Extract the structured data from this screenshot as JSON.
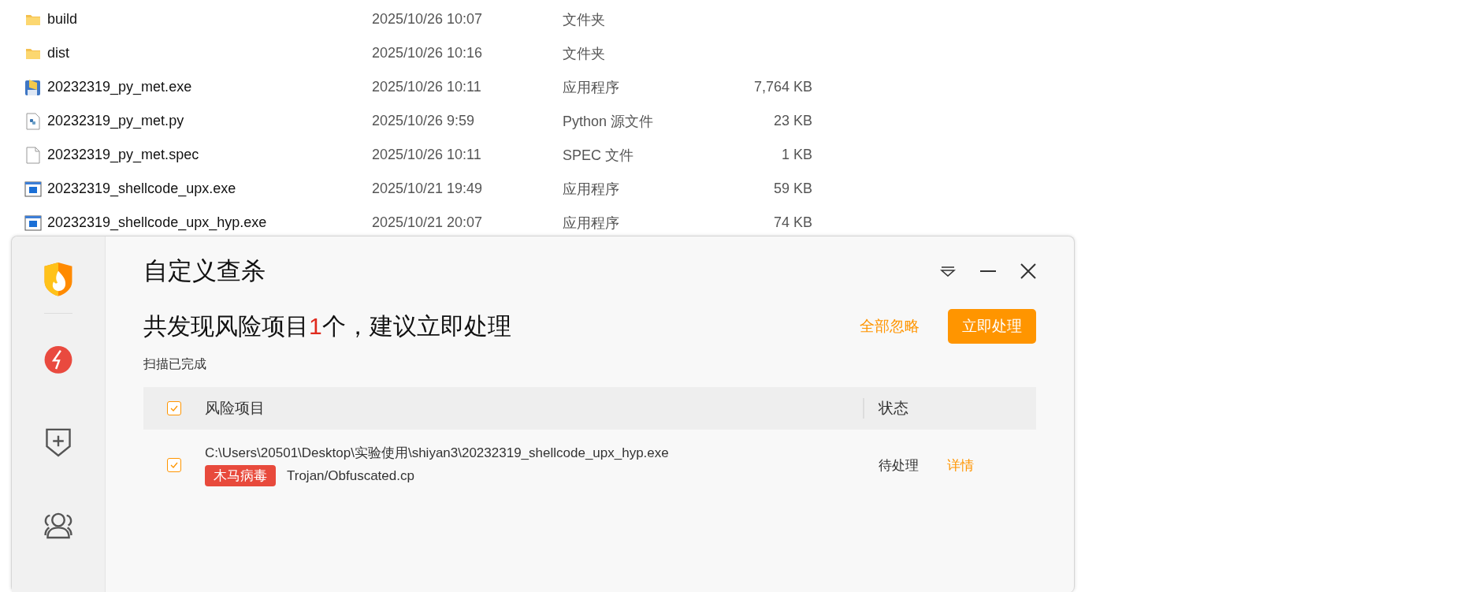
{
  "files": [
    {
      "kind": "folder",
      "name": "build",
      "modified": "2025/10/26 10:07",
      "type": "文件夹"
    },
    {
      "kind": "folder",
      "name": "dist",
      "modified": "2025/10/26 10:16",
      "type": "文件夹"
    },
    {
      "kind": "installer",
      "name": "20232319_py_met.exe",
      "modified": "2025/10/26 10:11",
      "type": "应用程序",
      "size": "7,764 KB"
    },
    {
      "kind": "python",
      "name": "20232319_py_met.py",
      "modified": "2025/10/26 9:59",
      "type": "Python 源文件",
      "size": "23 KB"
    },
    {
      "kind": "file",
      "name": "20232319_py_met.spec",
      "modified": "2025/10/26 10:11",
      "type": "SPEC 文件",
      "size": "1 KB"
    },
    {
      "kind": "app",
      "name": "20232319_shellcode_upx.exe",
      "modified": "2025/10/21 19:49",
      "type": "应用程序",
      "size": "59 KB"
    },
    {
      "kind": "app",
      "name": "20232319_shellcode_upx_hyp.exe",
      "modified": "2025/10/21 20:07",
      "type": "应用程序",
      "size": "74 KB"
    }
  ],
  "dialog": {
    "title": "自定义查杀",
    "summary_count": "1",
    "summary_prefix": "共发现风险项目",
    "summary_suffix": "个，建议立即处理",
    "status": "扫描已完成",
    "ignore_all": "全部忽略",
    "fix_now": "立即处理",
    "table": {
      "columns": [
        "风险项目",
        "状态"
      ],
      "all_checked": true,
      "rows": [
        {
          "checked": true,
          "path": "C:\\Users\\20501\\Desktop\\实验使用\\shiyan3\\20232319_shellcode_upx_hyp.exe",
          "tag": "木马病毒",
          "threat": "Trojan/Obfuscated.cp",
          "state": "待处理",
          "details": "详情"
        }
      ]
    }
  }
}
